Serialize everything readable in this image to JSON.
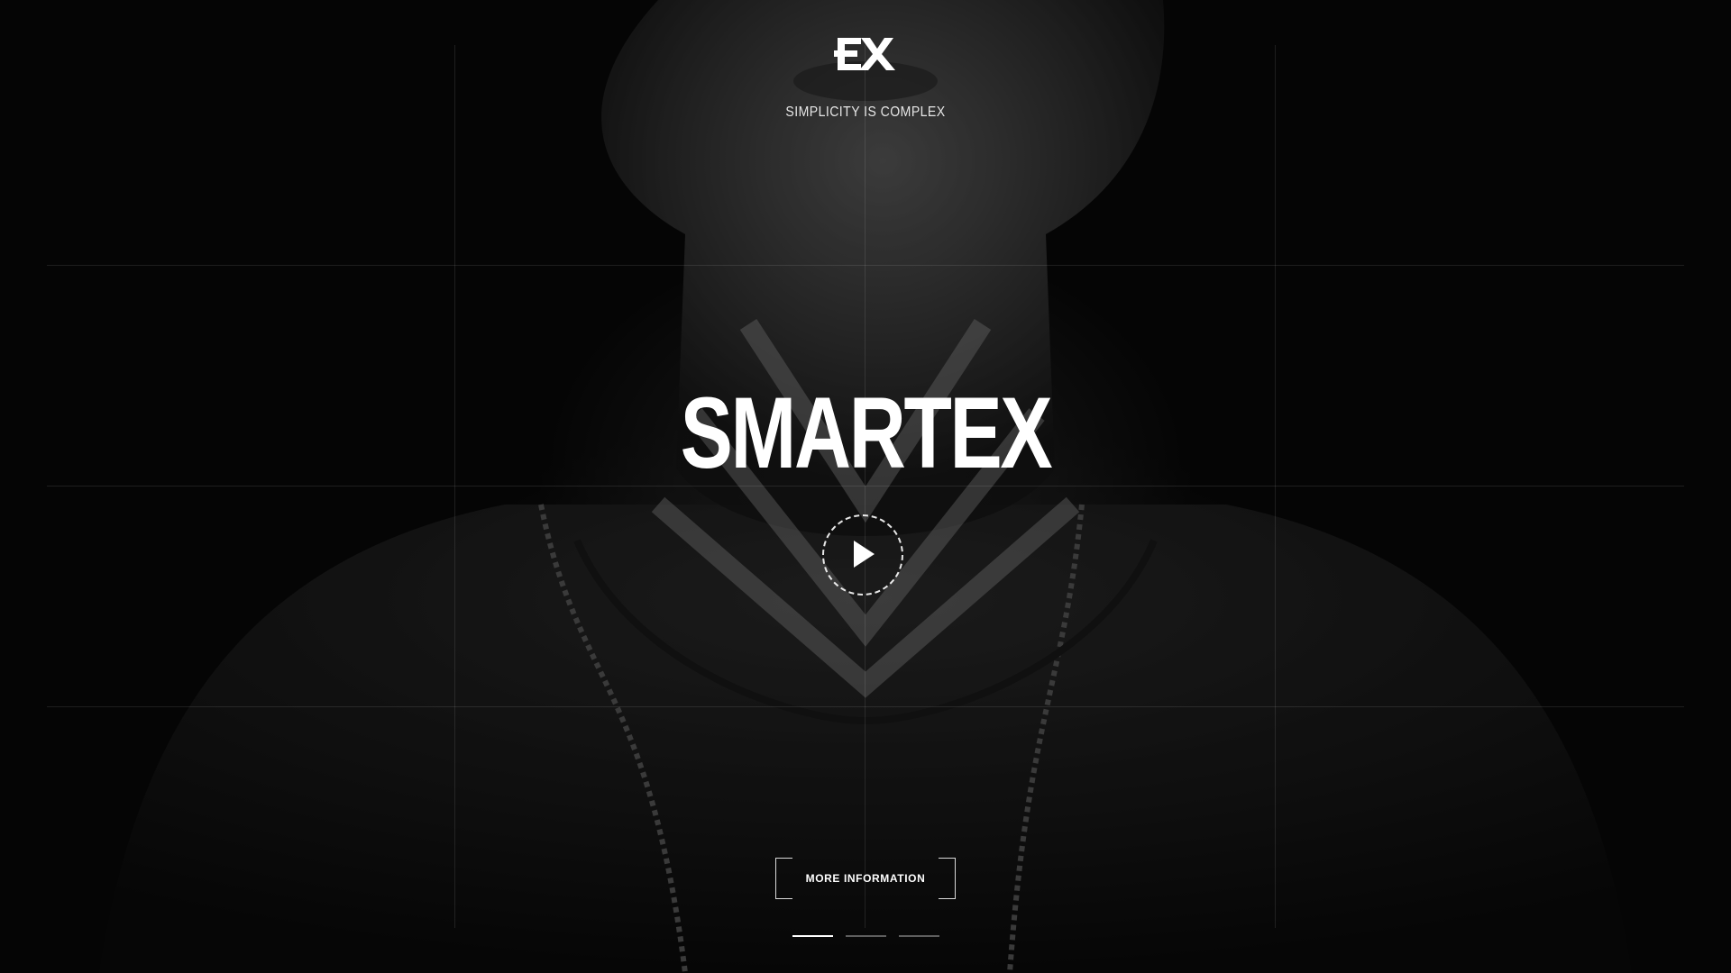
{
  "brand": {
    "logo_text": "EX",
    "tagline": "SIMPLICITY IS COMPLEX"
  },
  "hero": {
    "title": "SMARTEX",
    "play_icon": "play-icon"
  },
  "cta": {
    "more_label": "MORE INFORMATION"
  },
  "slider": {
    "slides": [
      {
        "active": true
      },
      {
        "active": false
      },
      {
        "active": false
      }
    ]
  },
  "colors": {
    "background": "#080808",
    "text": "#ffffff",
    "grid": "rgba(255,255,255,0.10)"
  }
}
